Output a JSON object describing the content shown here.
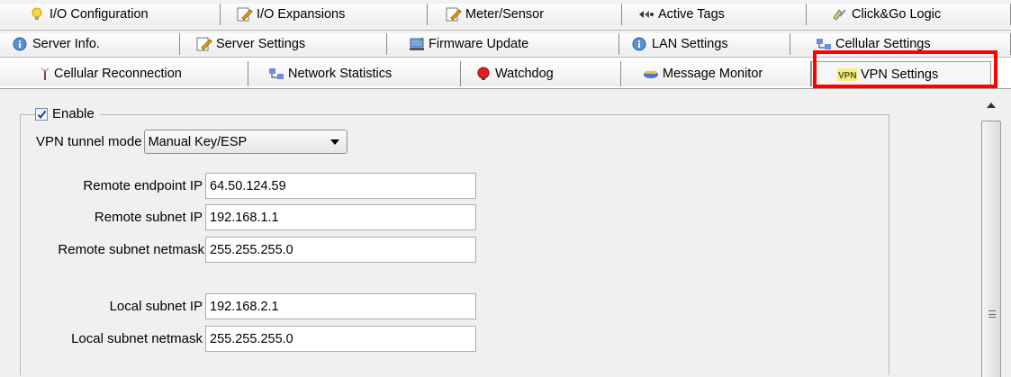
{
  "tabs": {
    "row1": [
      {
        "label": "I/O Configuration",
        "icon": "lightbulb-icon"
      },
      {
        "label": "I/O Expansions",
        "icon": "pencil-doc-icon"
      },
      {
        "label": "Meter/Sensor",
        "icon": "pencil-doc-icon"
      },
      {
        "label": "Active Tags",
        "icon": "tags-icon"
      },
      {
        "label": "Click&Go Logic",
        "icon": "logic-icon"
      }
    ],
    "row2": [
      {
        "label": "Server Info.",
        "icon": "info-icon"
      },
      {
        "label": "Server Settings",
        "icon": "pencil-doc-icon"
      },
      {
        "label": "Firmware Update",
        "icon": "firmware-icon"
      },
      {
        "label": "LAN Settings",
        "icon": "info-icon"
      },
      {
        "label": "Cellular Settings",
        "icon": "network-icon"
      }
    ],
    "row3": [
      {
        "label": "Cellular Reconnection",
        "icon": "antenna-icon"
      },
      {
        "label": "Network Statistics",
        "icon": "network-icon"
      },
      {
        "label": "Watchdog",
        "icon": "watchdog-icon"
      },
      {
        "label": "Message Monitor",
        "icon": "monitor-icon"
      },
      {
        "label": "VPN Settings",
        "icon": "vpn-icon"
      }
    ]
  },
  "form": {
    "enable_label": "Enable",
    "enable_checked": true,
    "tunnel_mode_label": "VPN tunnel mode",
    "tunnel_mode_value": "Manual Key/ESP",
    "remote_endpoint_label": "Remote endpoint IP",
    "remote_endpoint_value": "64.50.124.59",
    "remote_subnet_label": "Remote subnet IP",
    "remote_subnet_value": "192.168.1.1",
    "remote_netmask_label": "Remote subnet netmask",
    "remote_netmask_value": "255.255.255.0",
    "local_subnet_label": "Local subnet IP",
    "local_subnet_value": "192.168.2.1",
    "local_netmask_label": "Local subnet netmask",
    "local_netmask_value": "255.255.255.0"
  },
  "colors": {
    "highlight": "#ff0000",
    "panel_bg": "#f0f0f0"
  }
}
